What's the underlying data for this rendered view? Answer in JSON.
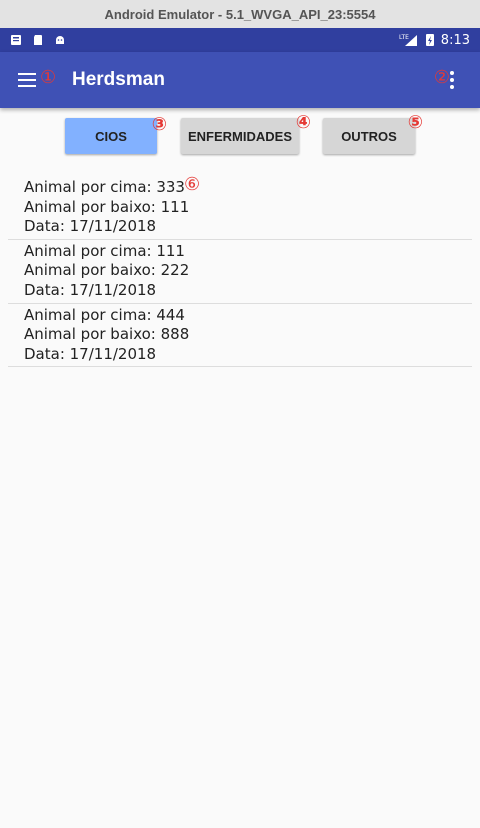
{
  "window": {
    "title": "Android Emulator - 5.1_WVGA_API_23:5554"
  },
  "statusbar": {
    "time": "8:13",
    "network_label": "LTE"
  },
  "toolbar": {
    "title": "Herdsman"
  },
  "tabs": [
    {
      "label": "CIOS",
      "selected": true
    },
    {
      "label": "ENFERMIDADES",
      "selected": false
    },
    {
      "label": "OUTROS",
      "selected": false
    }
  ],
  "markers": [
    "①",
    "②",
    "③",
    "④",
    "⑤",
    "⑥"
  ],
  "records": [
    {
      "cima": "Animal por cima: 333",
      "baixo": "Animal por baixo: 111",
      "data": "Data: 17/11/2018"
    },
    {
      "cima": "Animal por cima: 111",
      "baixo": "Animal por baixo: 222",
      "data": "Data: 17/11/2018"
    },
    {
      "cima": "Animal por cima: 444",
      "baixo": "Animal por baixo: 888",
      "data": "Data: 17/11/2018"
    }
  ],
  "colors": {
    "primary": "#3f51b5",
    "primary_dark": "#303f9f",
    "selected_tab": "#82b1ff",
    "tab": "#d6d6d6",
    "marker": "#e53935"
  }
}
